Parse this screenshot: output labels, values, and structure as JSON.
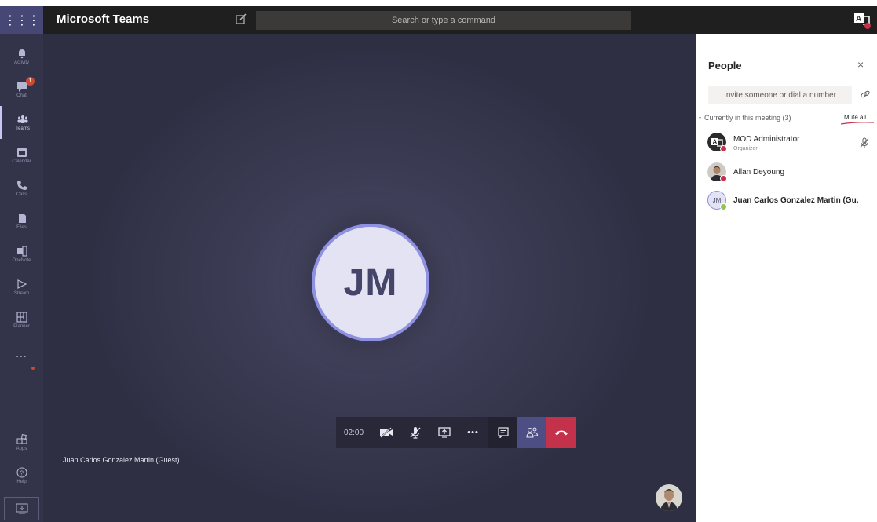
{
  "app": {
    "title": "Microsoft Teams",
    "search_placeholder": "Search or type a command"
  },
  "rail": {
    "items": [
      {
        "label": "Activity",
        "icon": "bell-icon"
      },
      {
        "label": "Chat",
        "icon": "chat-icon",
        "badge": "1"
      },
      {
        "label": "Teams",
        "icon": "teams-icon",
        "active": true
      },
      {
        "label": "Calendar",
        "icon": "calendar-icon"
      },
      {
        "label": "Calls",
        "icon": "phone-icon"
      },
      {
        "label": "Files",
        "icon": "file-icon"
      },
      {
        "label": "OneNote",
        "icon": "onenote-icon"
      },
      {
        "label": "Stream",
        "icon": "stream-icon"
      },
      {
        "label": "Planner",
        "icon": "planner-icon"
      }
    ],
    "more_label": "...",
    "bottom": [
      {
        "label": "Apps",
        "icon": "apps-icon"
      },
      {
        "label": "Help",
        "icon": "help-icon"
      }
    ]
  },
  "stage": {
    "avatar_initials": "JM",
    "participant_name": "Juan Carlos Gonzalez Martin (Guest)"
  },
  "controls": {
    "timer": "02:00",
    "more_label": "•••"
  },
  "people_panel": {
    "title": "People",
    "close_label": "×",
    "invite_placeholder": "Invite someone or dial a number",
    "section_title": "Currently in this meeting (3)",
    "mute_all_label": "Mute all",
    "participants": [
      {
        "name": "MOD Administrator",
        "role": "Organizer",
        "status_color": "#c4314b"
      },
      {
        "name": "Allan Deyoung",
        "role": "",
        "status_color": "#c4314b"
      },
      {
        "name": "Juan Carlos Gonzalez Martin (Gu.",
        "role": "",
        "initials": "JM",
        "status_color": "#92c353"
      }
    ]
  },
  "colors": {
    "rail": "#33344a",
    "accent": "#464775",
    "hangup": "#c4314b",
    "stage": "#2f2f44"
  }
}
